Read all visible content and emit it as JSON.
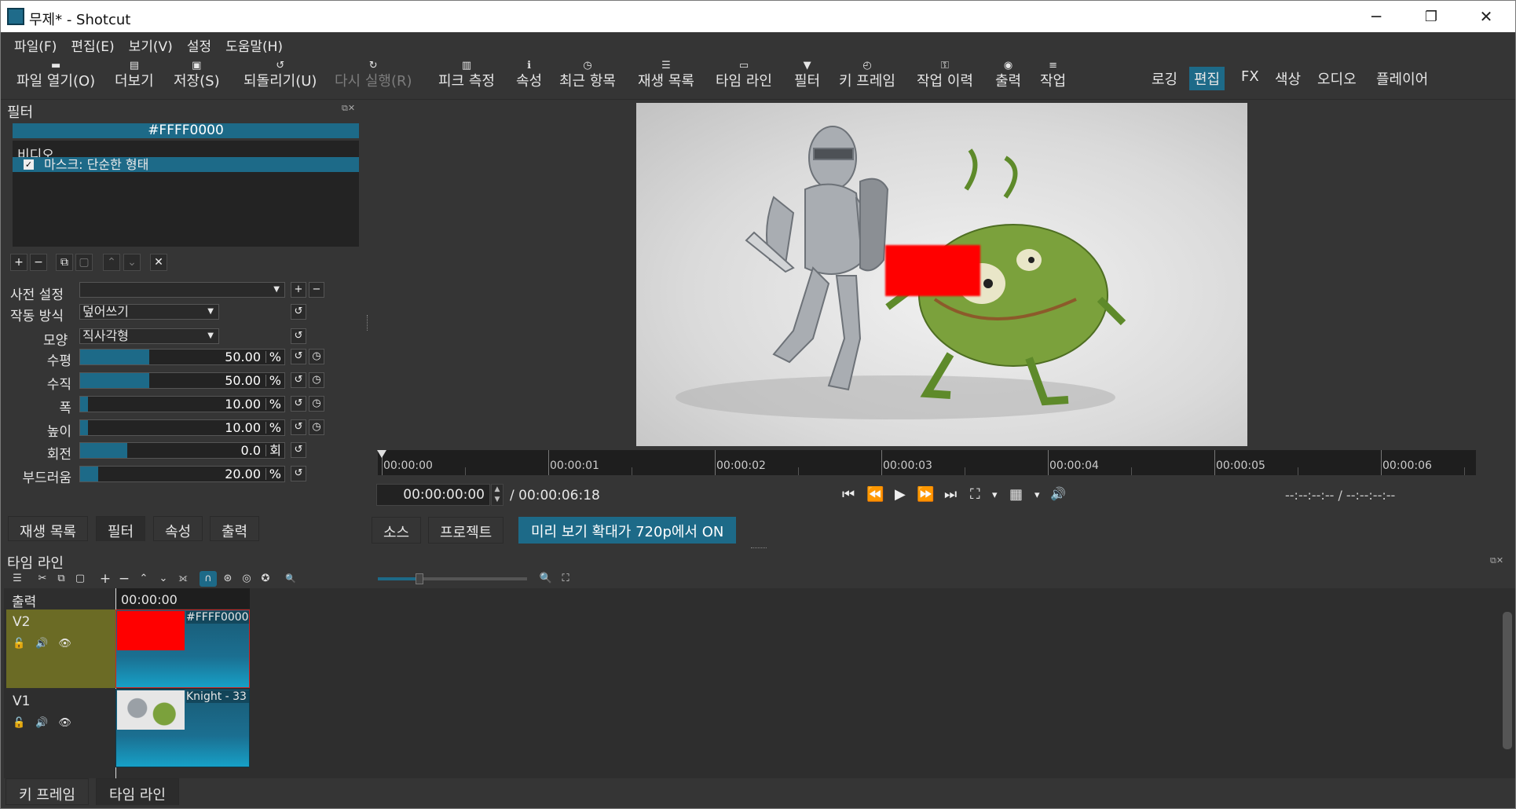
{
  "window": {
    "title": "무제* - Shotcut",
    "minimize": "─",
    "restore": "❐",
    "close": "✕"
  },
  "menubar": [
    "파일(F)",
    "편집(E)",
    "보기(V)",
    "설정",
    "도움말(H)"
  ],
  "toolbar": [
    {
      "icon": "▬",
      "label": "파일 열기(O)",
      "disabled": false
    },
    {
      "icon": "▤",
      "label": "더보기",
      "disabled": false
    },
    {
      "icon": "▣",
      "label": "저장(S)",
      "disabled": false
    },
    {
      "icon": "↺",
      "label": "되돌리기(U)",
      "disabled": false
    },
    {
      "icon": "↻",
      "label": "다시 실행(R)",
      "disabled": true
    },
    {
      "icon": "▥",
      "label": "피크 측정",
      "disabled": false
    },
    {
      "icon": "ℹ",
      "label": "속성",
      "disabled": false
    },
    {
      "icon": "◷",
      "label": "최근 항목",
      "disabled": false
    },
    {
      "icon": "☰",
      "label": "재생 목록",
      "disabled": false
    },
    {
      "icon": "▭",
      "label": "타임 라인",
      "disabled": false
    },
    {
      "icon": "▼",
      "label": "필터",
      "disabled": false
    },
    {
      "icon": "◴",
      "label": "키 프레임",
      "disabled": false
    },
    {
      "icon": "⚿",
      "label": "작업 이력",
      "disabled": false
    },
    {
      "icon": "◉",
      "label": "출력",
      "disabled": false
    },
    {
      "icon": "≡",
      "label": "작업",
      "disabled": false
    }
  ],
  "workspaces": [
    {
      "label": "로깅",
      "active": false
    },
    {
      "label": "편집",
      "active": true
    },
    {
      "label": "FX",
      "active": false
    },
    {
      "label": "색상",
      "active": false
    },
    {
      "label": "오디오",
      "active": false
    },
    {
      "label": "플레이어",
      "active": false
    }
  ],
  "filters_panel": {
    "title": "필터",
    "clip_name": "#FFFF0000",
    "category": "비디오",
    "item": {
      "label": "마스크: 단순한 형태",
      "checked": true,
      "check_mark": "✓"
    },
    "buttons": [
      "+",
      "−",
      "⧉",
      "▢",
      "⌃",
      "⌄",
      "✕"
    ],
    "preset_label": "사전 설정",
    "preset_value": "",
    "preset_add": "+",
    "preset_remove": "−",
    "operation_label": "작동 방식",
    "operation_value": "덮어쓰기",
    "shape_label": "모양",
    "shape_value": "직사각형",
    "reset_icon": "↺",
    "keyframe_icon": "◷",
    "params": [
      {
        "label": "수평",
        "value": "50.00",
        "unit": "%",
        "fraction": 0.34
      },
      {
        "label": "수직",
        "value": "50.00",
        "unit": "%",
        "fraction": 0.34
      },
      {
        "label": "폭",
        "value": "10.00",
        "unit": "%",
        "fraction": 0.04
      },
      {
        "label": "높이",
        "value": "10.00",
        "unit": "%",
        "fraction": 0.04
      },
      {
        "label": "회전",
        "value": "0.0",
        "unit": "회",
        "fraction": 0.23
      },
      {
        "label": "부드러움",
        "value": "20.00",
        "unit": "%",
        "fraction": 0.09
      }
    ],
    "tabs": [
      {
        "label": "재생 목록",
        "active": false
      },
      {
        "label": "필터",
        "active": true
      },
      {
        "label": "속성",
        "active": false
      },
      {
        "label": "출력",
        "active": false
      }
    ]
  },
  "viewer": {
    "ruler_labels": [
      "00:00:00",
      "00:00:01",
      "00:00:02",
      "00:00:03",
      "00:00:04",
      "00:00:05",
      "00:00:06"
    ],
    "timecode": "00:00:00:00",
    "duration": "/ 00:00:06:18",
    "in_out": "--:--:--:-- /        --:--:--:--",
    "transport": [
      "⏮",
      "⏪",
      "▶",
      "⏩",
      "⏭",
      "⛶",
      "▾",
      "▦",
      "▾",
      "🔊"
    ],
    "tabs": [
      {
        "label": "소스",
        "active": false
      },
      {
        "label": "프로젝트",
        "active": false
      }
    ],
    "zoom_note": "미리 보기 확대가 720p에서 ON"
  },
  "timeline": {
    "title": "타임 라인",
    "output_label": "출력",
    "ruler_time": "00:00:00",
    "tools": [
      "☰",
      "✂",
      "⧉",
      "▢",
      "+",
      "−",
      "⌃",
      "⌄",
      "⟗",
      "∩",
      "⊛",
      "◎",
      "✪",
      "🔍",
      "🔍",
      "⛶"
    ],
    "zoom_fraction": 0.28,
    "tracks": [
      {
        "name": "V2",
        "clip_name": "#FFFF0000",
        "icons": [
          "🔓",
          "🔊",
          "👁"
        ]
      },
      {
        "name": "V1",
        "clip_name": "Knight - 33",
        "icons": [
          "🔓",
          "🔊",
          "👁"
        ]
      }
    ]
  },
  "bottom_tabs": [
    {
      "label": "키 프레임",
      "active": false
    },
    {
      "label": "타임 라인",
      "active": true
    }
  ],
  "colors": {
    "accent": "#1d6a88",
    "mask_red": "#ff0000",
    "track_v2": "#6b6b25",
    "panel_bg": "#353535"
  }
}
